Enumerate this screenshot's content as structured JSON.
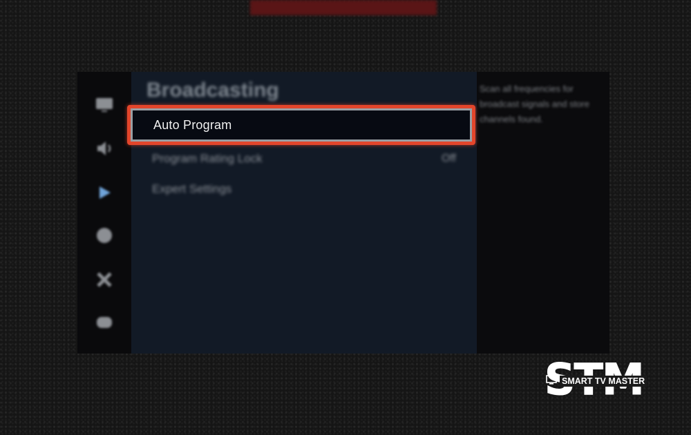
{
  "screen": {
    "menu_title": "Broadcasting",
    "focused_item": "Auto Program",
    "rows": [
      {
        "label": "Program Rating Lock",
        "value": "Off"
      },
      {
        "label": "Expert Settings",
        "value": ""
      }
    ],
    "help_text": "Scan all frequencies for broadcast signals and store channels found."
  },
  "icons": [
    "picture-icon",
    "sound-icon",
    "broadcasting-icon",
    "network-icon",
    "system-icon",
    "support-icon"
  ],
  "watermark": {
    "big": "STM",
    "sub": "SMART TV MASTER"
  },
  "colors": {
    "focus_border": "#e3452b",
    "menu_bg": "#121a26",
    "active_icon": "#6fa3d9"
  }
}
